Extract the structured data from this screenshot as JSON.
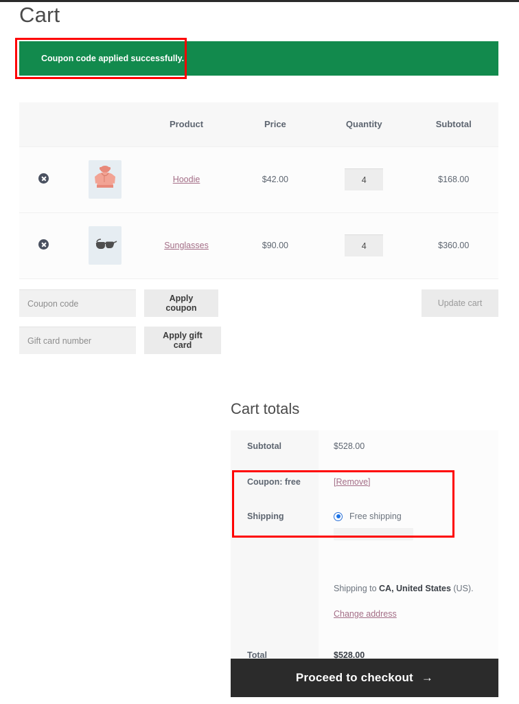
{
  "page": {
    "title": "Cart"
  },
  "notice": {
    "message": "Coupon code applied successfully.",
    "background_color": "#128a4d",
    "text_color": "#ffffff"
  },
  "annotations": {
    "highlight_color": "#fe0000",
    "boxes": [
      {
        "name": "notice-highlight"
      },
      {
        "name": "totals-coupon-shipping-highlight"
      }
    ]
  },
  "cart_table": {
    "headers": {
      "remove": "",
      "thumbnail": "",
      "product": "Product",
      "price": "Price",
      "quantity": "Quantity",
      "subtotal": "Subtotal"
    },
    "rows": [
      {
        "remove_label": "Remove this item",
        "thumbnail_icon": "hoodie-thumbnail",
        "product": "Hoodie",
        "price": "$42.00",
        "quantity": "4",
        "subtotal": "$168.00"
      },
      {
        "remove_label": "Remove this item",
        "thumbnail_icon": "sunglasses-thumbnail",
        "product": "Sunglasses",
        "price": "$90.00",
        "quantity": "4",
        "subtotal": "$360.00"
      }
    ]
  },
  "coupon_area": {
    "coupon_input_value": "",
    "coupon_placeholder": "Coupon code",
    "apply_coupon_label": "Apply coupon",
    "giftcard_input_value": "",
    "giftcard_placeholder": "Gift card number",
    "apply_giftcard_label": "Apply gift card",
    "update_cart_label": "Update cart"
  },
  "totals": {
    "title": "Cart totals",
    "subtotal_label": "Subtotal",
    "subtotal_value": "$528.00",
    "coupon_label": "Coupon: free",
    "coupon_remove_open": "[",
    "coupon_remove_text": "Remove",
    "coupon_remove_close": "]",
    "shipping_label": "Shipping",
    "shipping_option": "Free shipping",
    "shipping_option_selected": true,
    "shipping_to_prefix": "Shipping to ",
    "shipping_to_location": "CA, United States",
    "shipping_to_suffix": " (US).",
    "change_address_label": "Change address",
    "total_label": "Total",
    "total_value": "$528.00"
  },
  "checkout": {
    "label": "Proceed to checkout",
    "arrow": "→"
  }
}
